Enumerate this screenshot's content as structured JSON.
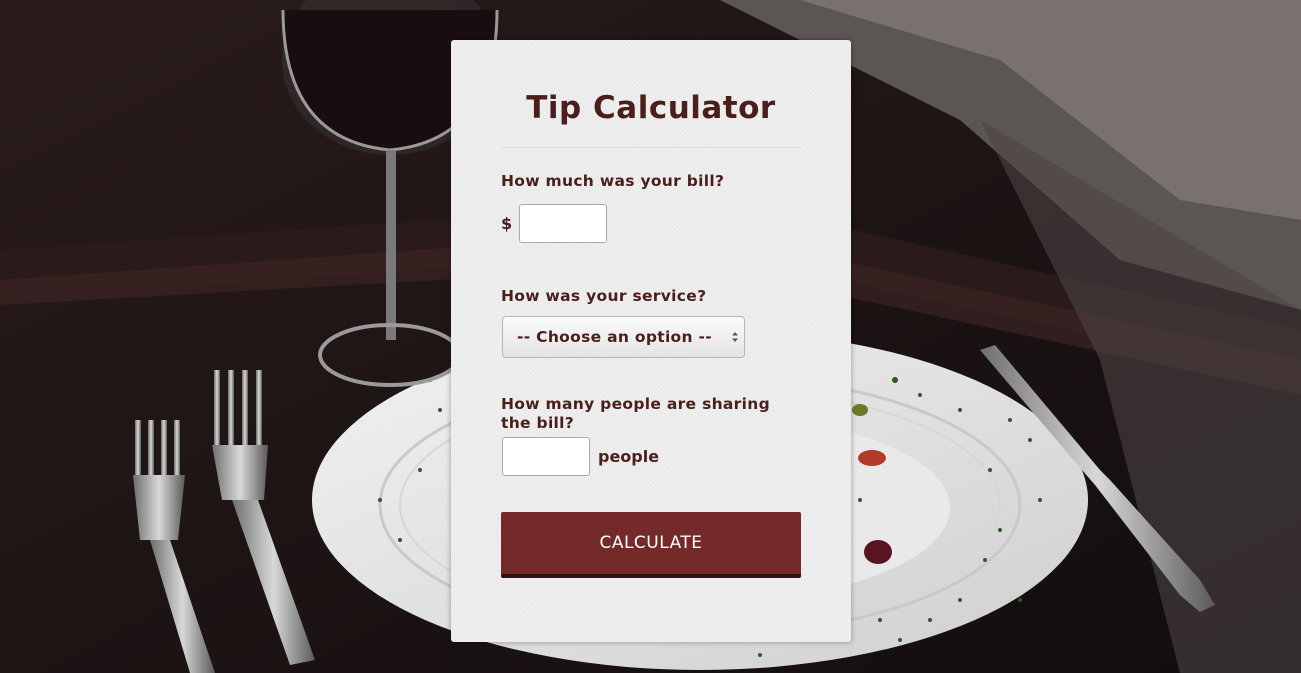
{
  "app": {
    "title": "Tip Calculator"
  },
  "form": {
    "bill": {
      "question": "How much was your bill?",
      "currency_symbol": "$",
      "value": "",
      "placeholder": ""
    },
    "service": {
      "question": "How was your service?",
      "selected_option": "-- Choose an option --"
    },
    "people": {
      "question": "How many people are sharing the bill?",
      "value": "",
      "placeholder": "",
      "suffix": "people"
    },
    "calculate_label": "CALCULATE"
  },
  "colors": {
    "text_brown": "#4a1e1b",
    "button_red": "#732a28",
    "button_shadow": "#2e1514",
    "card_bg": "#efefef"
  },
  "icons": {
    "select_arrows": "updown-arrows-icon"
  }
}
